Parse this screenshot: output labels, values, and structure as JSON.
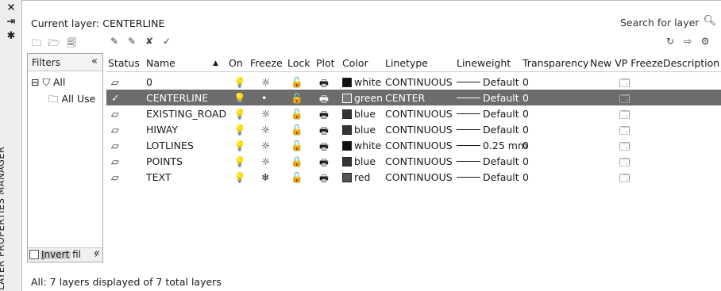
{
  "palette": {
    "title": "LAYER PROPERTIES MANAGER",
    "controls": [
      "×",
      "⇥",
      "✱"
    ]
  },
  "current_layer_label": "Current layer: CENTERLINE",
  "search": {
    "placeholder": "Search for layer",
    "icon": "search-icon"
  },
  "filters": {
    "header": "Filters",
    "collapse": "«",
    "tree": [
      {
        "label": "All",
        "expander": "⊟",
        "icon": "filter-tree-icon"
      },
      {
        "label": "All Use",
        "icon": "filter-group-icon"
      }
    ],
    "invert_label_u": "I",
    "invert_label_rest": "nvert fil",
    "invert_collapse": "«"
  },
  "columns": {
    "status": "Status",
    "name": "Name",
    "sort": "▲",
    "on": "On",
    "freeze": "Freeze",
    "lock": "Lock",
    "plot": "Plot",
    "color": "Color",
    "linetype": "Linetype",
    "lineweight": "Lineweight",
    "transparency": "Transparency",
    "new_vp_freeze": "New VP Freeze",
    "description": "Description"
  },
  "layers": [
    {
      "status": "▱",
      "name": "0",
      "on": "💡",
      "freeze": "☼",
      "lock": "🔓",
      "plot": "🖶",
      "color_name": "white",
      "color_hex": "#111111",
      "linetype": "CONTINUOUS",
      "lineweight": "Default",
      "transparency": "0",
      "vp": "🗔",
      "selected": false
    },
    {
      "status": "✓",
      "name": "CENTERLINE",
      "on": "💡",
      "freeze": "•",
      "lock": "🔓",
      "plot": "🖶",
      "color_name": "green",
      "color_hex": "#7a7a7a",
      "linetype": "CENTER",
      "lineweight": "Default",
      "transparency": "0",
      "vp": "🗔",
      "selected": true
    },
    {
      "status": "▱",
      "name": "EXISTING_ROAD",
      "on": "💡",
      "freeze": "☼",
      "lock": "🔓",
      "plot": "🖶",
      "color_name": "blue",
      "color_hex": "#333333",
      "linetype": "CONTINUOUS",
      "lineweight": "Default",
      "transparency": "0",
      "vp": "🗔",
      "selected": false
    },
    {
      "status": "▱",
      "name": "HIWAY",
      "on": "💡",
      "freeze": "☼",
      "lock": "🔓",
      "plot": "🖶",
      "color_name": "blue",
      "color_hex": "#333333",
      "linetype": "CONTINUOUS",
      "lineweight": "Default",
      "transparency": "0",
      "vp": "🗔",
      "selected": false
    },
    {
      "status": "▱",
      "name": "LOTLINES",
      "on": "💡",
      "freeze": "☼",
      "lock": "🔓",
      "plot": "🖶",
      "color_name": "white",
      "color_hex": "#111111",
      "linetype": "CONTINUOUS",
      "lineweight": "0.25 mm",
      "transparency": "0",
      "vp": "🗔",
      "selected": false
    },
    {
      "status": "▱",
      "name": "POINTS",
      "on": "💡",
      "freeze": "☼",
      "lock": "🔒",
      "plot": "🖶",
      "color_name": "blue",
      "color_hex": "#333333",
      "linetype": "CONTINUOUS",
      "lineweight": "Default",
      "transparency": "0",
      "vp": "🗔",
      "selected": false
    },
    {
      "status": "▱",
      "name": "TEXT",
      "on": "💡",
      "freeze": "❄",
      "lock": "🔓",
      "plot": "🖶",
      "color_name": "red",
      "color_hex": "#555555",
      "linetype": "CONTINUOUS",
      "lineweight": "Default",
      "transparency": "0",
      "vp": "🗔",
      "selected": false
    }
  ],
  "status_bar": "All: 7 layers displayed of 7 total layers"
}
